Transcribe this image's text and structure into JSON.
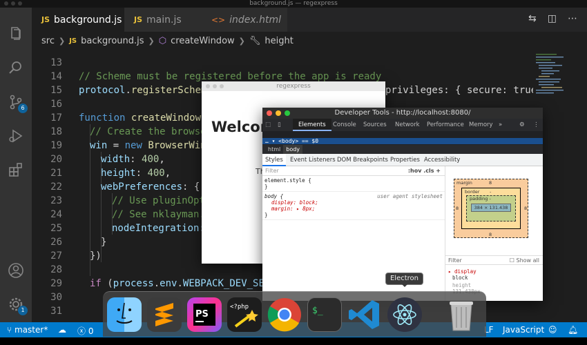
{
  "window": {
    "title": "background.js — regexpress"
  },
  "activity": {
    "scm_badge": "6",
    "settings_badge": "1"
  },
  "tabs": [
    {
      "label": "background.js",
      "type": "JS",
      "close": "✕"
    },
    {
      "label": "main.js",
      "type": "JS"
    },
    {
      "label": "index.html",
      "type": "<>"
    }
  ],
  "breadcrumb": {
    "folder": "src",
    "file": "background.js",
    "file_type": "JS",
    "function": "createWindow",
    "symbol": "height"
  },
  "editor": {
    "line_numbers": [
      "13",
      "14",
      "15",
      "16",
      "17",
      "18",
      "19",
      "20",
      "21",
      "22",
      "23",
      "24",
      "25",
      "26",
      "27",
      "28",
      "29",
      "30",
      "31"
    ],
    "lines": {
      "l14": "// Scheme must be registered before the app is ready",
      "l15a": "protocol",
      "l15b": "registerScheme",
      "l15c": "privileges: { secure: true,",
      "l17a": "function",
      "l17b": "createWindow",
      "l18": "// Create the browse",
      "l19a": "win",
      "l19b": "new",
      "l19c": "BrowserWin",
      "l20a": "width",
      "l20b": "400",
      "l21a": "height",
      "l21b": "400",
      "l22": "webPreferences",
      "l23": "// Use pluginOpt",
      "l24": "// See nklayman.",
      "l25": "nodeIntegration:",
      "l26": "}",
      "l27": "})",
      "l29a": "if",
      "l29b": "process",
      "l29c": "env",
      "l29d": "WEBPACK_DEV_SER"
    }
  },
  "app_window": {
    "title": "regexpress",
    "heading": "Welcom",
    "text": "Th"
  },
  "devtools": {
    "title": "Developer Tools - http://localhost:8080/",
    "tabs": [
      "Elements",
      "Console",
      "Sources",
      "Network",
      "Performance",
      "Memory",
      "»"
    ],
    "dom_selected": "… ▾ <body> == $0",
    "crumbs": [
      "html",
      "body"
    ],
    "subtabs": [
      "Styles",
      "Event Listeners",
      "DOM Breakpoints",
      "Properties",
      "Accessibility"
    ],
    "filter_placeholder": "Filter",
    "hov_cls": ":hov .cls +",
    "rules": {
      "element_style": "element.style {",
      "close": "}",
      "body_selector": "body {",
      "ua": "user agent stylesheet",
      "display": "display: block;",
      "margin": "margin: ▸ 8px;"
    },
    "box_model": {
      "margin_label": "margin",
      "margin_value": "8",
      "border_label": "border",
      "border_value": "-",
      "padding_label": "padding -",
      "content": "384 × 131.438"
    },
    "computed_filter": "Filter",
    "show_all": "Show all",
    "computed": [
      {
        "prop": "▸ display",
        "value": "block"
      },
      {
        "prop": "height",
        "value": "131.438px"
      }
    ]
  },
  "dock": {
    "tooltip": "Electron",
    "apps": [
      "Finder",
      "Sublime Text",
      "PhpStorm",
      "Php",
      "Chrome",
      "Terminal",
      "VS Code",
      "Electron",
      "Trash"
    ],
    "trash_icon_name": "trash-icon"
  },
  "status": {
    "branch": "master*",
    "errors": "0",
    "eol": "LF",
    "language": "JavaScript"
  },
  "colors": {
    "statusbar": "#007acc",
    "editor_bg": "#1e1e1e",
    "activity_bg": "#333333"
  }
}
